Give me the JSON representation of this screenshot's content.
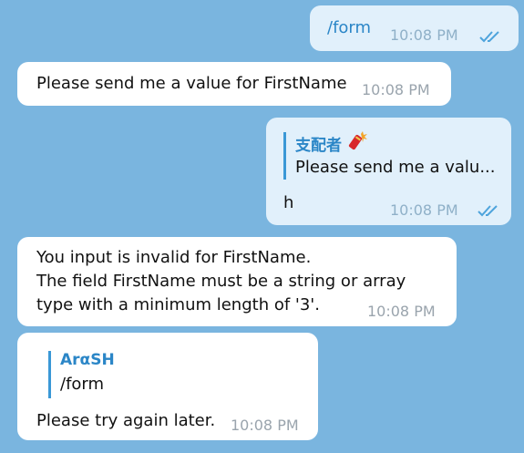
{
  "messages": [
    {
      "text": "/form",
      "time": "10:08 PM"
    },
    {
      "text": "Please send me a value for FirstName",
      "time": "10:08 PM"
    },
    {
      "reply_name": "支配者",
      "reply_text": "Please send me a valu...",
      "text": "h",
      "time": "10:08 PM"
    },
    {
      "lines": [
        "You input is invalid for FirstName.",
        "The field FirstName must be a string or array",
        "type with a minimum length of '3'."
      ],
      "time": "10:08 PM"
    },
    {
      "reply_name": "ArαSH",
      "reply_text": "/form",
      "text": "Please try again later.",
      "time": "10:08 PM"
    }
  ],
  "colors": {
    "background": "#7ab5df",
    "outgoing": "#e1f0fb",
    "incoming": "#ffffff",
    "accent": "#2b86c7"
  },
  "icons": {
    "read_receipt": "double-check-icon",
    "firecracker": "firecracker-emoji"
  }
}
